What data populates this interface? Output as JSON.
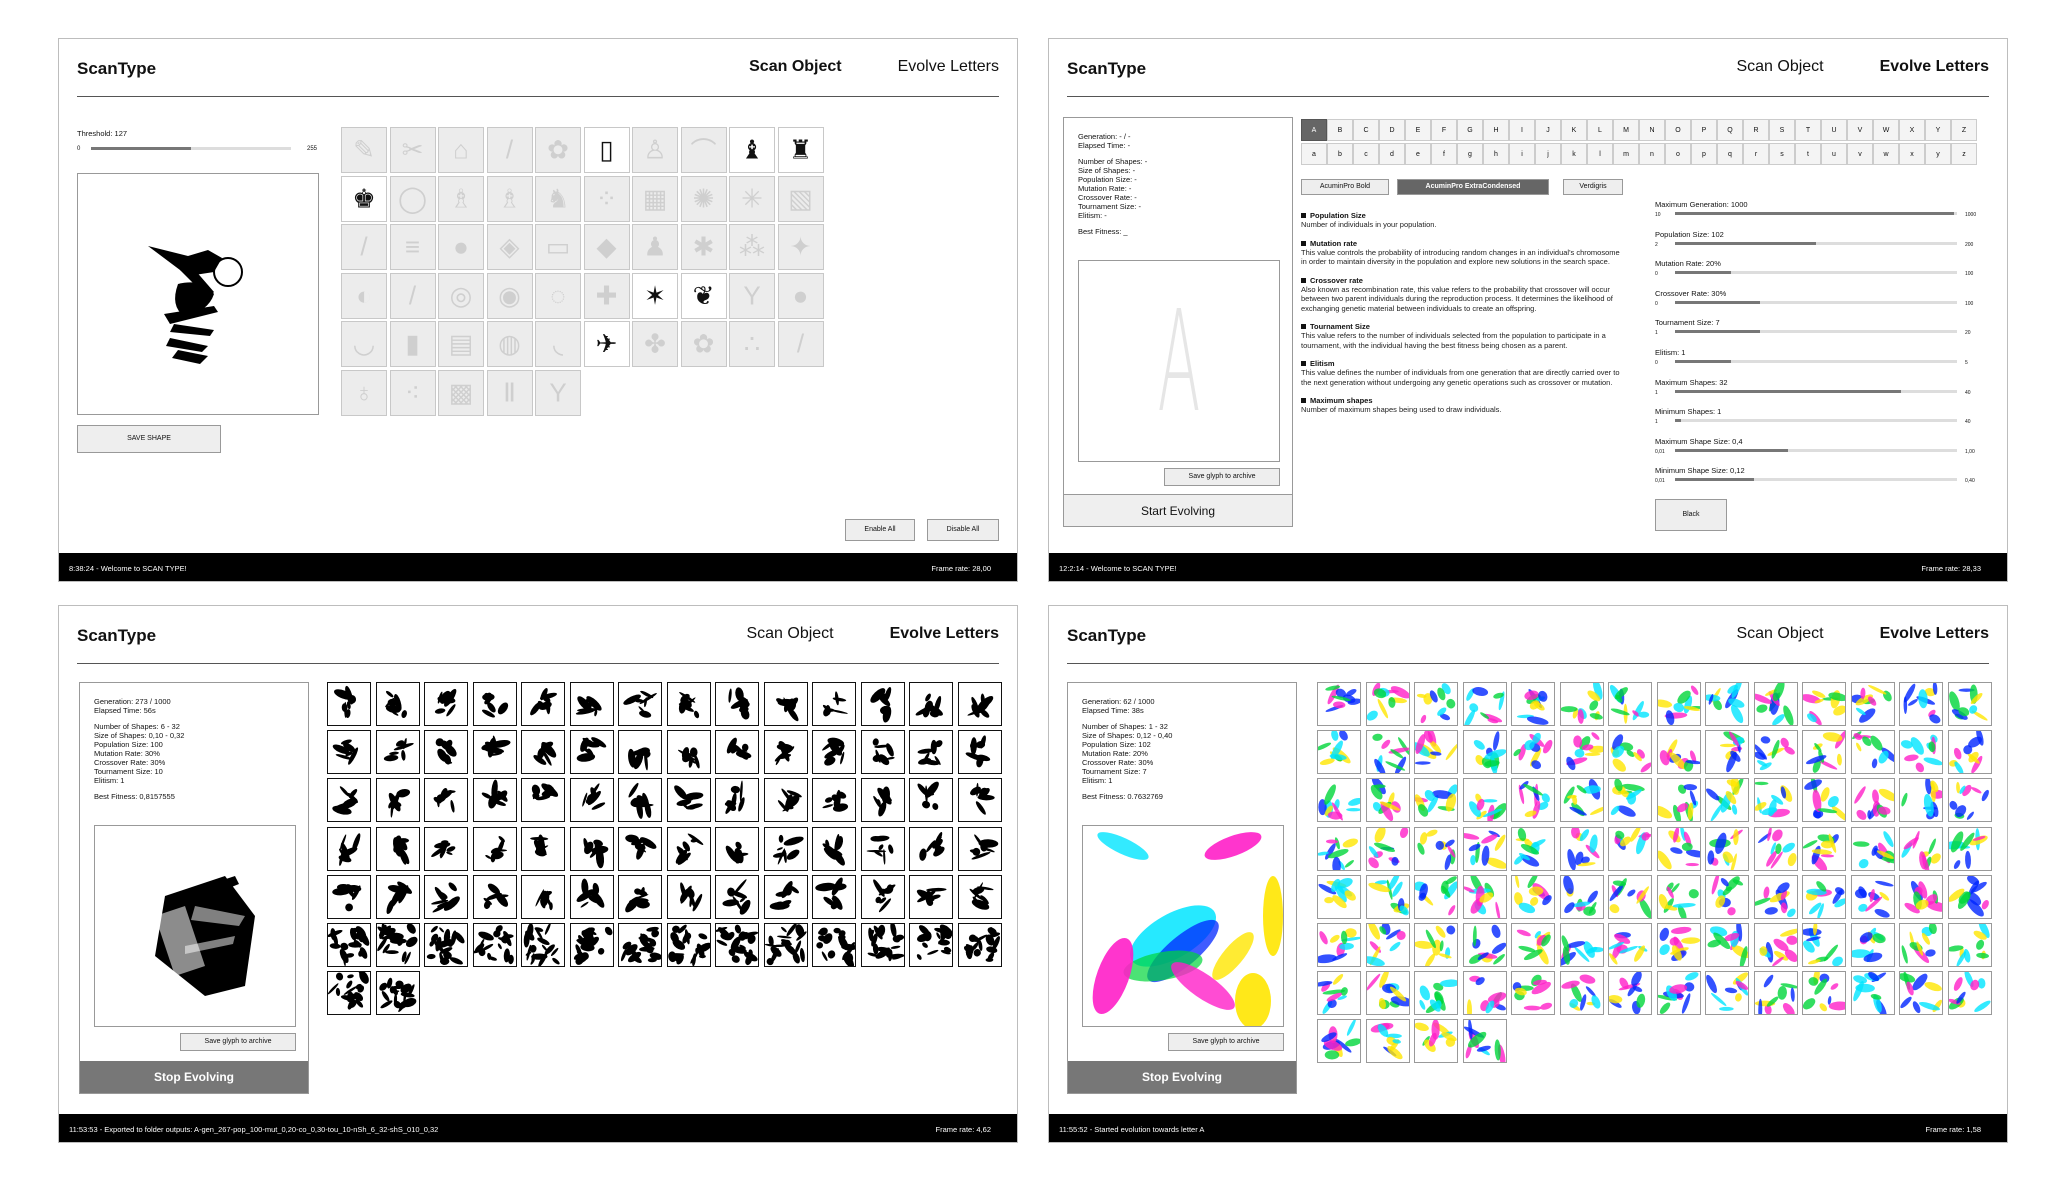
{
  "app": {
    "brand": "ScanType",
    "nav_scan": "Scan Object",
    "nav_evolve": "Evolve Letters"
  },
  "panel1": {
    "threshold_label": "Threshold: 127",
    "threshold_min": "0",
    "threshold_max": "255",
    "threshold_value": 0.5,
    "save_shape": "SAVE SHAPE",
    "enable_all": "Enable All",
    "disable_all": "Disable All",
    "status_left": "8:38:24 - Welcome to SCAN TYPE!",
    "status_right": "Frame rate: 28,00",
    "objects": [
      {
        "g": "✎",
        "on": false
      },
      {
        "g": "✂",
        "on": false
      },
      {
        "g": "⌂",
        "on": false
      },
      {
        "g": "/",
        "on": false
      },
      {
        "g": "✿",
        "on": false
      },
      {
        "g": "▯",
        "on": true
      },
      {
        "g": "♙",
        "on": false
      },
      {
        "g": "⌒",
        "on": false
      },
      {
        "g": "♝",
        "on": true
      },
      {
        "g": "♜",
        "on": true
      },
      {
        "g": "♚",
        "on": true
      },
      {
        "g": "◯",
        "on": false
      },
      {
        "g": "♗",
        "on": false
      },
      {
        "g": "♗",
        "on": false
      },
      {
        "g": "♞",
        "on": false
      },
      {
        "g": "⁘",
        "on": false
      },
      {
        "g": "▦",
        "on": false
      },
      {
        "g": "✺",
        "on": false
      },
      {
        "g": "✳",
        "on": false
      },
      {
        "g": "▧",
        "on": false
      },
      {
        "g": "/",
        "on": false
      },
      {
        "g": "≡",
        "on": false
      },
      {
        "g": "●",
        "on": false
      },
      {
        "g": "◈",
        "on": false
      },
      {
        "g": "▭",
        "on": false
      },
      {
        "g": "◆",
        "on": false
      },
      {
        "g": "♟",
        "on": false
      },
      {
        "g": "✱",
        "on": false
      },
      {
        "g": "⁂",
        "on": false
      },
      {
        "g": "✦",
        "on": false
      },
      {
        "g": "◐",
        "on": false
      },
      {
        "g": "/",
        "on": false
      },
      {
        "g": "◎",
        "on": false
      },
      {
        "g": "◉",
        "on": false
      },
      {
        "g": "◌",
        "on": false
      },
      {
        "g": "✚",
        "on": false
      },
      {
        "g": "✶",
        "on": true
      },
      {
        "g": "❦",
        "on": true
      },
      {
        "g": "Y",
        "on": false
      },
      {
        "g": "●",
        "on": false
      },
      {
        "g": "◡",
        "on": false
      },
      {
        "g": "▮",
        "on": false
      },
      {
        "g": "▤",
        "on": false
      },
      {
        "g": "◍",
        "on": false
      },
      {
        "g": "◟",
        "on": false
      },
      {
        "g": "✈",
        "on": true
      },
      {
        "g": "✤",
        "on": false
      },
      {
        "g": "✿",
        "on": false
      },
      {
        "g": "∴",
        "on": false
      },
      {
        "g": "/",
        "on": false
      },
      {
        "g": "♁",
        "on": false
      },
      {
        "g": "⁖",
        "on": false
      },
      {
        "g": "▩",
        "on": false
      },
      {
        "g": "Ⅱ",
        "on": false
      },
      {
        "g": "Y",
        "on": false
      }
    ]
  },
  "panel2": {
    "info": [
      "Generation: - / -",
      "Elapsed Time: -",
      "",
      "Number of Shapes: -",
      "Size of Shapes: -",
      "Population Size: -",
      "Mutation Rate: -",
      "Crossover Rate: -",
      "Tournament Size: -",
      "Elitism: -",
      "",
      "Best Fitness: _"
    ],
    "preview_letter": "A",
    "save_glyph": "Save glyph to archive",
    "start": "Start Evolving",
    "upper": [
      "A",
      "B",
      "C",
      "D",
      "E",
      "F",
      "G",
      "H",
      "I",
      "J",
      "K",
      "L",
      "M",
      "N",
      "O",
      "P",
      "Q",
      "R",
      "S",
      "T",
      "U",
      "V",
      "W",
      "X",
      "Y",
      "Z"
    ],
    "lower": [
      "a",
      "b",
      "c",
      "d",
      "e",
      "f",
      "g",
      "h",
      "i",
      "j",
      "k",
      "l",
      "m",
      "n",
      "o",
      "p",
      "q",
      "r",
      "s",
      "t",
      "u",
      "v",
      "w",
      "x",
      "y",
      "z"
    ],
    "fonts": [
      "AcuminPro Bold",
      "AcuminPro ExtraCondensed",
      "Verdigris"
    ],
    "params": [
      {
        "t": "Population Size",
        "d": "Number of individuals in your population."
      },
      {
        "t": "Mutation rate",
        "d": "This value controls the probability of introducing random changes in an individual's chromosome in order to maintain diversity in the population and explore new solutions in the search space."
      },
      {
        "t": "Crossover rate",
        "d": "Also known as recombination rate, this value refers to the probability that crossover will occur between two parent individuals during the reproduction process. It determines the likelihood of exchanging genetic material between individuals to create an offspring."
      },
      {
        "t": "Tournament Size",
        "d": "This value refers to the number of individuals selected from the population to participate in a tournament, with the individual having the best fitness being chosen as a parent."
      },
      {
        "t": "Elitism",
        "d": "This value defines the number of individuals from one generation that are directly carried over to the next generation without undergoing any genetic operations such as crossover or mutation."
      },
      {
        "t": "Maximum shapes",
        "d": "Number of maximum shapes being used to draw individuals."
      }
    ],
    "sliders": [
      {
        "l": "Maximum Generation: 1000",
        "min": "10",
        "max": "1000",
        "v": 0.99
      },
      {
        "l": "Population Size: 102",
        "min": "2",
        "max": "200",
        "v": 0.5
      },
      {
        "l": "Mutation Rate: 20%",
        "min": "0",
        "max": "100",
        "v": 0.2
      },
      {
        "l": "Crossover Rate: 30%",
        "min": "0",
        "max": "100",
        "v": 0.3
      },
      {
        "l": "Tournament Size: 7",
        "min": "1",
        "max": "20",
        "v": 0.3
      },
      {
        "l": "Elitism: 1",
        "min": "0",
        "max": "5",
        "v": 0.2
      },
      {
        "l": "Maximum Shapes: 32",
        "min": "1",
        "max": "40",
        "v": 0.8
      },
      {
        "l": "Minimum Shapes: 1",
        "min": "1",
        "max": "40",
        "v": 0.02
      },
      {
        "l": "Maximum Shape Size: 0,4",
        "min": "0,01",
        "max": "1,00",
        "v": 0.4
      },
      {
        "l": "Minimum Shape Size: 0,12",
        "min": "0,01",
        "max": "0,40",
        "v": 0.28
      }
    ],
    "black": "Black",
    "status_left": "12:2:14 - Welcome to SCAN TYPE!",
    "status_right": "Frame rate: 28,33"
  },
  "panel3": {
    "info": [
      "Generation: 273 / 1000",
      "Elapsed Time: 56s",
      "",
      "Number of Shapes: 6 - 32",
      "Size of Shapes: 0,10 - 0,32",
      "Population Size: 100",
      "Mutation Rate: 30%",
      "Crossover Rate: 30%",
      "Tournament Size: 10",
      "Elitism: 1",
      "",
      "Best Fitness: 0,8157555"
    ],
    "save_glyph": "Save glyph to archive",
    "stop": "Stop Evolving",
    "status_left": "11:53:53 - Exported to folder outputs: A-gen_267-pop_100-mut_0,20-co_0,30-tou_10-nSh_6_32-shS_010_0,32",
    "status_right": "Frame rate: 4,62",
    "count": 86
  },
  "panel4": {
    "info": [
      "Generation: 62 / 1000",
      "Elapsed Time: 38s",
      "",
      "Number of Shapes: 1 - 32",
      "Size of Shapes: 0,12 - 0,40",
      "Population Size: 102",
      "Mutation Rate: 20%",
      "Crossover Rate: 30%",
      "Tournament Size: 7",
      "Elitism: 1",
      "",
      "Best Fitness: 0.7632769"
    ],
    "save_glyph": "Save glyph to archive",
    "stop": "Stop Evolving",
    "status_left": "11:55:52 - Started evolution towards letter A",
    "status_right": "Frame rate: 1,58",
    "count": 102,
    "colors": [
      "#00e5ff",
      "#ff1fc8",
      "#ffe600",
      "#0026ff",
      "#00d63a"
    ]
  }
}
